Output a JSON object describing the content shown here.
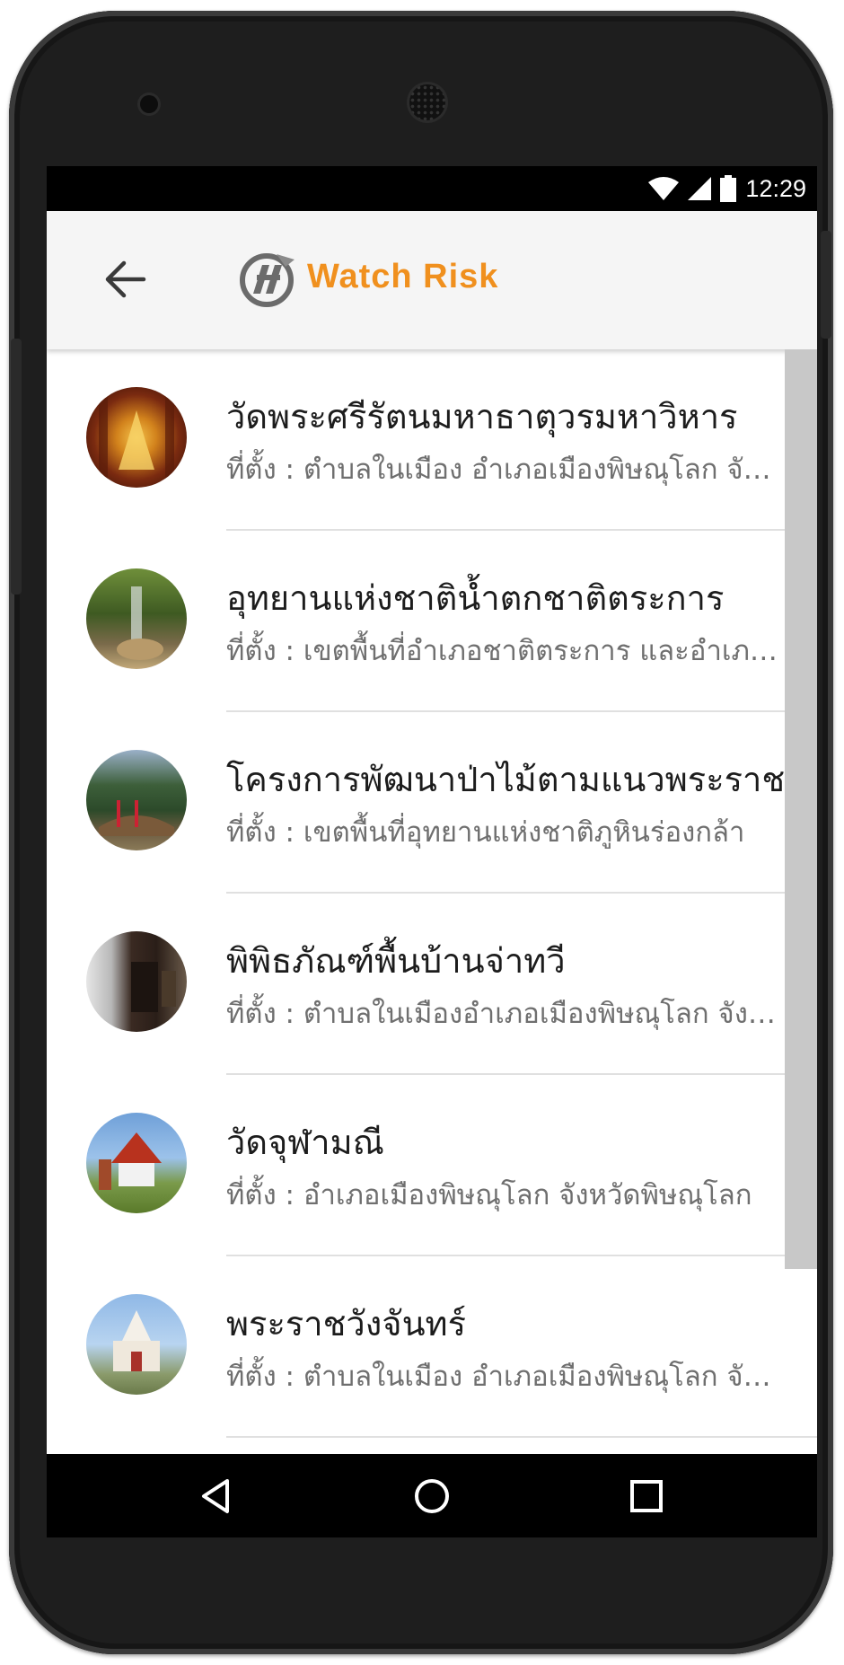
{
  "status_bar": {
    "time": "12:29",
    "icons": [
      "wifi-icon",
      "signal-icon",
      "battery-icon"
    ]
  },
  "app_bar": {
    "brand": "Watch Risk",
    "back_icon": "arrow-left-icon",
    "logo_icon": "watch-risk-logo"
  },
  "colors": {
    "brand_orange": "#f0901e",
    "app_bar_bg": "#f5f5f5",
    "divider": "#e0e0e0",
    "scrollbar": "#c8c8c8"
  },
  "places": [
    {
      "title": "วัดพระศรีรัตนมหาธาตุวรมหาวิหาร",
      "subtitle": "ที่ตั้ง : ตำบลในเมือง อำเภอเมืองพิษณุโลก จังหวัดพิษณุโลก"
    },
    {
      "title": "อุทยานแห่งชาติน้ำตกชาติตระการ",
      "subtitle": "ที่ตั้ง : เขตพื้นที่อำเภอชาติตระการ และอำเภอนครไทย"
    },
    {
      "title": "โครงการพัฒนาป่าไม้ตามแนวพระราชดำริ",
      "subtitle": "ที่ตั้ง : เขตพื้นที่อุทยานแห่งชาติภูหินร่องกล้า"
    },
    {
      "title": "พิพิธภัณฑ์พื้นบ้านจ่าทวี",
      "subtitle": "ที่ตั้ง : ตำบลในเมืองอำเภอเมืองพิษณุโลก จังหวัดพิษณุโลก"
    },
    {
      "title": "วัดจุฬามณี",
      "subtitle": "ที่ตั้ง : อำเภอเมืองพิษณุโลก จังหวัดพิษณุโลก"
    },
    {
      "title": "พระราชวังจันทร์",
      "subtitle": "ที่ตั้ง : ตำบลในเมือง อำเภอเมืองพิษณุโลก จังหวัดพิษณุโลก"
    }
  ],
  "nav_bar": {
    "back": "back-triangle-icon",
    "home": "home-circle-icon",
    "recents": "recents-square-icon"
  }
}
